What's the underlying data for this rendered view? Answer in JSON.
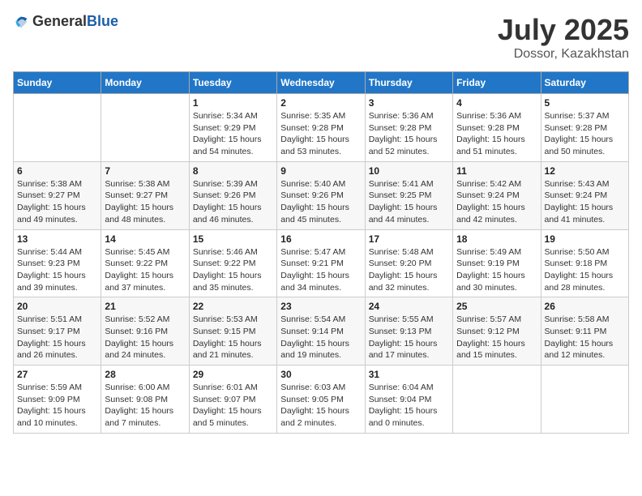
{
  "header": {
    "logo_general": "General",
    "logo_blue": "Blue",
    "month_year": "July 2025",
    "location": "Dossor, Kazakhstan"
  },
  "weekdays": [
    "Sunday",
    "Monday",
    "Tuesday",
    "Wednesday",
    "Thursday",
    "Friday",
    "Saturday"
  ],
  "weeks": [
    [
      {
        "day": "",
        "info": ""
      },
      {
        "day": "",
        "info": ""
      },
      {
        "day": "1",
        "info": "Sunrise: 5:34 AM\nSunset: 9:29 PM\nDaylight: 15 hours and 54 minutes."
      },
      {
        "day": "2",
        "info": "Sunrise: 5:35 AM\nSunset: 9:28 PM\nDaylight: 15 hours and 53 minutes."
      },
      {
        "day": "3",
        "info": "Sunrise: 5:36 AM\nSunset: 9:28 PM\nDaylight: 15 hours and 52 minutes."
      },
      {
        "day": "4",
        "info": "Sunrise: 5:36 AM\nSunset: 9:28 PM\nDaylight: 15 hours and 51 minutes."
      },
      {
        "day": "5",
        "info": "Sunrise: 5:37 AM\nSunset: 9:28 PM\nDaylight: 15 hours and 50 minutes."
      }
    ],
    [
      {
        "day": "6",
        "info": "Sunrise: 5:38 AM\nSunset: 9:27 PM\nDaylight: 15 hours and 49 minutes."
      },
      {
        "day": "7",
        "info": "Sunrise: 5:38 AM\nSunset: 9:27 PM\nDaylight: 15 hours and 48 minutes."
      },
      {
        "day": "8",
        "info": "Sunrise: 5:39 AM\nSunset: 9:26 PM\nDaylight: 15 hours and 46 minutes."
      },
      {
        "day": "9",
        "info": "Sunrise: 5:40 AM\nSunset: 9:26 PM\nDaylight: 15 hours and 45 minutes."
      },
      {
        "day": "10",
        "info": "Sunrise: 5:41 AM\nSunset: 9:25 PM\nDaylight: 15 hours and 44 minutes."
      },
      {
        "day": "11",
        "info": "Sunrise: 5:42 AM\nSunset: 9:24 PM\nDaylight: 15 hours and 42 minutes."
      },
      {
        "day": "12",
        "info": "Sunrise: 5:43 AM\nSunset: 9:24 PM\nDaylight: 15 hours and 41 minutes."
      }
    ],
    [
      {
        "day": "13",
        "info": "Sunrise: 5:44 AM\nSunset: 9:23 PM\nDaylight: 15 hours and 39 minutes."
      },
      {
        "day": "14",
        "info": "Sunrise: 5:45 AM\nSunset: 9:22 PM\nDaylight: 15 hours and 37 minutes."
      },
      {
        "day": "15",
        "info": "Sunrise: 5:46 AM\nSunset: 9:22 PM\nDaylight: 15 hours and 35 minutes."
      },
      {
        "day": "16",
        "info": "Sunrise: 5:47 AM\nSunset: 9:21 PM\nDaylight: 15 hours and 34 minutes."
      },
      {
        "day": "17",
        "info": "Sunrise: 5:48 AM\nSunset: 9:20 PM\nDaylight: 15 hours and 32 minutes."
      },
      {
        "day": "18",
        "info": "Sunrise: 5:49 AM\nSunset: 9:19 PM\nDaylight: 15 hours and 30 minutes."
      },
      {
        "day": "19",
        "info": "Sunrise: 5:50 AM\nSunset: 9:18 PM\nDaylight: 15 hours and 28 minutes."
      }
    ],
    [
      {
        "day": "20",
        "info": "Sunrise: 5:51 AM\nSunset: 9:17 PM\nDaylight: 15 hours and 26 minutes."
      },
      {
        "day": "21",
        "info": "Sunrise: 5:52 AM\nSunset: 9:16 PM\nDaylight: 15 hours and 24 minutes."
      },
      {
        "day": "22",
        "info": "Sunrise: 5:53 AM\nSunset: 9:15 PM\nDaylight: 15 hours and 21 minutes."
      },
      {
        "day": "23",
        "info": "Sunrise: 5:54 AM\nSunset: 9:14 PM\nDaylight: 15 hours and 19 minutes."
      },
      {
        "day": "24",
        "info": "Sunrise: 5:55 AM\nSunset: 9:13 PM\nDaylight: 15 hours and 17 minutes."
      },
      {
        "day": "25",
        "info": "Sunrise: 5:57 AM\nSunset: 9:12 PM\nDaylight: 15 hours and 15 minutes."
      },
      {
        "day": "26",
        "info": "Sunrise: 5:58 AM\nSunset: 9:11 PM\nDaylight: 15 hours and 12 minutes."
      }
    ],
    [
      {
        "day": "27",
        "info": "Sunrise: 5:59 AM\nSunset: 9:09 PM\nDaylight: 15 hours and 10 minutes."
      },
      {
        "day": "28",
        "info": "Sunrise: 6:00 AM\nSunset: 9:08 PM\nDaylight: 15 hours and 7 minutes."
      },
      {
        "day": "29",
        "info": "Sunrise: 6:01 AM\nSunset: 9:07 PM\nDaylight: 15 hours and 5 minutes."
      },
      {
        "day": "30",
        "info": "Sunrise: 6:03 AM\nSunset: 9:05 PM\nDaylight: 15 hours and 2 minutes."
      },
      {
        "day": "31",
        "info": "Sunrise: 6:04 AM\nSunset: 9:04 PM\nDaylight: 15 hours and 0 minutes."
      },
      {
        "day": "",
        "info": ""
      },
      {
        "day": "",
        "info": ""
      }
    ]
  ]
}
